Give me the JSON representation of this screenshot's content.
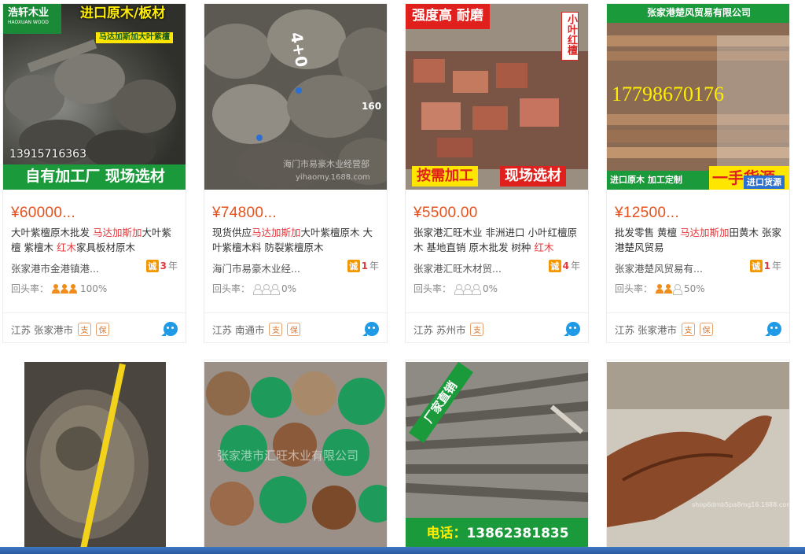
{
  "products": [
    {
      "overlays": {
        "brand": "浩轩木业",
        "brand_sub": "HAOXUAN WOOD",
        "banner": "进口原木/板材",
        "sub_banner": "马达加斯加大叶紫檀",
        "phone": "13915716363",
        "footer": "自有加工厂 现场选材"
      },
      "price": "¥60000...",
      "title_parts": [
        "大叶紫檀原木批发 ",
        "马达加斯加",
        "大叶紫檀 紫檀木 ",
        "红木",
        "家具板材原木"
      ],
      "seller": "张家港市金港镇港...",
      "cheng": "诚",
      "years": "3",
      "years_unit": "年",
      "repeat_label": "回头率：",
      "repeat_level": 3,
      "repeat_rate": "100%",
      "location": "江苏 张家港市",
      "badges": [
        "支",
        "保"
      ]
    },
    {
      "overlays": {
        "watermark": "海门市易豪木业经营部",
        "watermark2": "yihaomy.1688.com",
        "mark1": "4+0",
        "mark2": "160"
      },
      "price": "¥74800...",
      "title_parts": [
        "现货供应",
        "马达加斯加",
        "大叶紫檀原木 大叶紫檀木料 防裂紫檀原木"
      ],
      "seller": "海门市易豪木业经...",
      "cheng": "诚",
      "years": "1",
      "years_unit": "年",
      "repeat_label": "回头率：",
      "repeat_level": 0,
      "repeat_rate": "0%",
      "location": "江苏 南通市",
      "badges": [
        "支",
        "保"
      ]
    },
    {
      "overlays": {
        "banner": "强度高 耐磨",
        "seal": "小叶红檀",
        "footer_left": "按需加工",
        "footer_right": "现场选材"
      },
      "price": "¥5500.00",
      "title_parts": [
        "张家港汇旺木业 非洲进口 小叶红檀原木 基地直销 原木批发 树种 ",
        "红木"
      ],
      "seller": "张家港汇旺木材贸...",
      "cheng": "诚",
      "years": "4",
      "years_unit": "年",
      "repeat_label": "回头率：",
      "repeat_level": 0,
      "repeat_rate": "0%",
      "location": "江苏 苏州市",
      "badges": [
        "支"
      ]
    },
    {
      "overlays": {
        "banner": "张家港楚风贸易有限公司",
        "phone": "17798670176",
        "footer_left": "进口原木 加工定制",
        "footer_big": "一手货源",
        "footer_tag": "进口货源"
      },
      "price": "¥12500...",
      "title_parts": [
        "批发零售 黄檀 ",
        "马达加斯加",
        "田黄木 张家港楚风贸易"
      ],
      "seller": "张家港楚风贸易有...",
      "cheng": "诚",
      "years": "1",
      "years_unit": "年",
      "repeat_label": "回头率：",
      "repeat_level": 2,
      "repeat_rate": "50%",
      "location": "江苏 张家港市",
      "badges": [
        "支",
        "保"
      ]
    },
    {
      "overlays": {}
    },
    {
      "overlays": {
        "watermark": "张家港市汇旺木业有限公司"
      }
    },
    {
      "overlays": {
        "corner": "厂家直销",
        "phone_label": "电话：",
        "phone": "13862381835"
      }
    },
    {
      "overlays": {
        "watermark": "shop6dmb5pa8mg16.1688.com"
      }
    }
  ],
  "colors": {
    "price": "#e5511d",
    "highlight": "#e4393c",
    "green_banner": "#1a9a3a",
    "chat": "#1e9ae6"
  }
}
